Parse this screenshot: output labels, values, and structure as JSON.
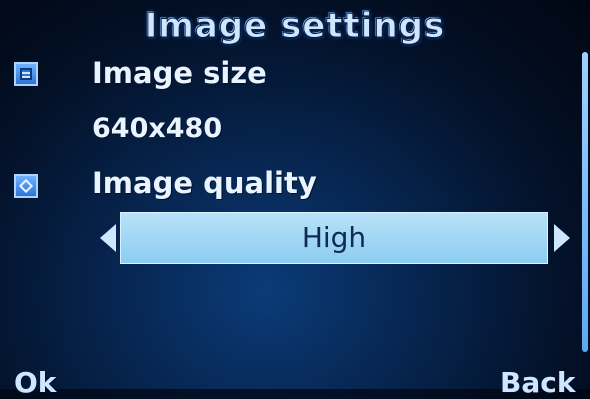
{
  "header": {
    "title": "Image settings"
  },
  "settings": [
    {
      "label": "Image size",
      "value": "640x480",
      "icon": "image-size-icon"
    },
    {
      "label": "Image quality",
      "value": "High",
      "icon": "image-quality-icon"
    }
  ],
  "softkeys": {
    "left": "Ok",
    "right": "Back"
  },
  "colors": {
    "selector_bg": "#9fd6f4",
    "selector_text": "#0d2b55",
    "text": "#eaf4ff"
  }
}
